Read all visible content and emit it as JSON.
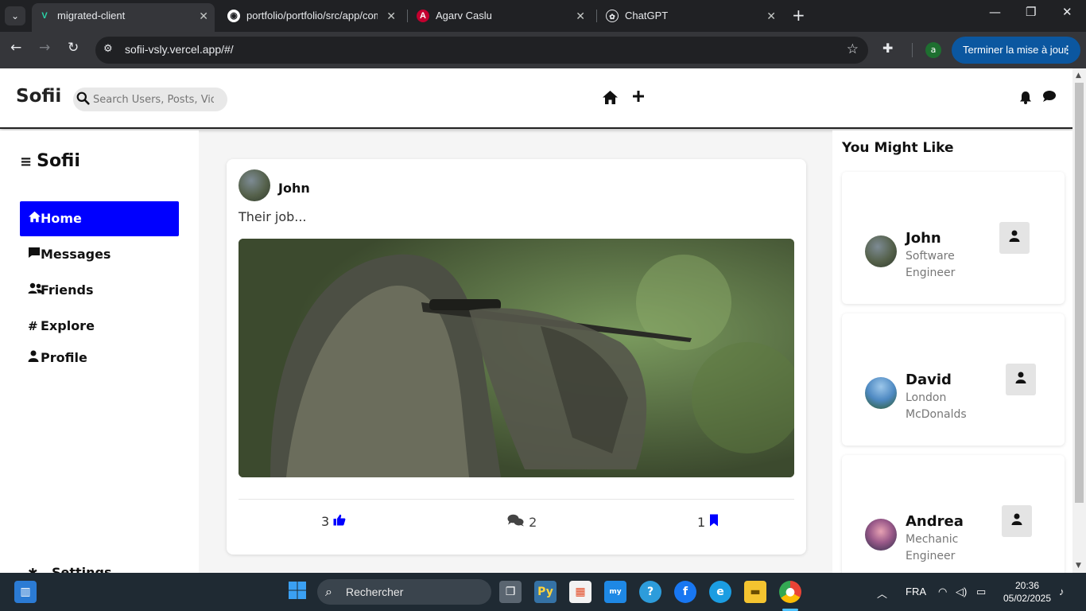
{
  "browser": {
    "tabs": [
      {
        "title": "migrated-client",
        "favicon": "V",
        "active": true
      },
      {
        "title": "portfolio/portfolio/src/app/com",
        "favicon": "github",
        "active": false
      },
      {
        "title": "Agarv Caslu",
        "favicon": "A",
        "active": false
      },
      {
        "title": "ChatGPT",
        "favicon": "chatgpt",
        "active": false
      }
    ],
    "url": "sofii-vsly.vercel.app/#/",
    "profile_initial": "a",
    "update_button": "Terminer la mise à jour"
  },
  "app": {
    "brand": "Sofii",
    "search_placeholder": "Search Users, Posts, Videos"
  },
  "sidebar": {
    "title": "Sofii",
    "items": [
      {
        "label": "Home",
        "icon": "home-icon",
        "active": true
      },
      {
        "label": "Messages",
        "icon": "message-icon",
        "active": false
      },
      {
        "label": "Friends",
        "icon": "friends-icon",
        "active": false
      },
      {
        "label": "Explore",
        "icon": "hashtag-icon",
        "active": false
      },
      {
        "label": "Profile",
        "icon": "user-icon",
        "active": false
      }
    ],
    "settings_label": "Settings"
  },
  "post": {
    "user": "John",
    "caption": "Their job...",
    "likes": "3",
    "comments": "2",
    "saves": "1"
  },
  "suggestions": {
    "title": "You Might Like",
    "users": [
      {
        "name": "John",
        "role": "Software Engineer"
      },
      {
        "name": "David",
        "role": "London McDonalds"
      },
      {
        "name": "Andrea",
        "role": "Mechanic Engineer"
      }
    ]
  },
  "taskbar": {
    "search_label": "Rechercher",
    "language": "FRA",
    "time": "20:36",
    "date": "05/02/2025"
  },
  "colors": {
    "accent": "#0000ff",
    "chrome_dark": "#202124",
    "update_button": "#0b57a0"
  }
}
